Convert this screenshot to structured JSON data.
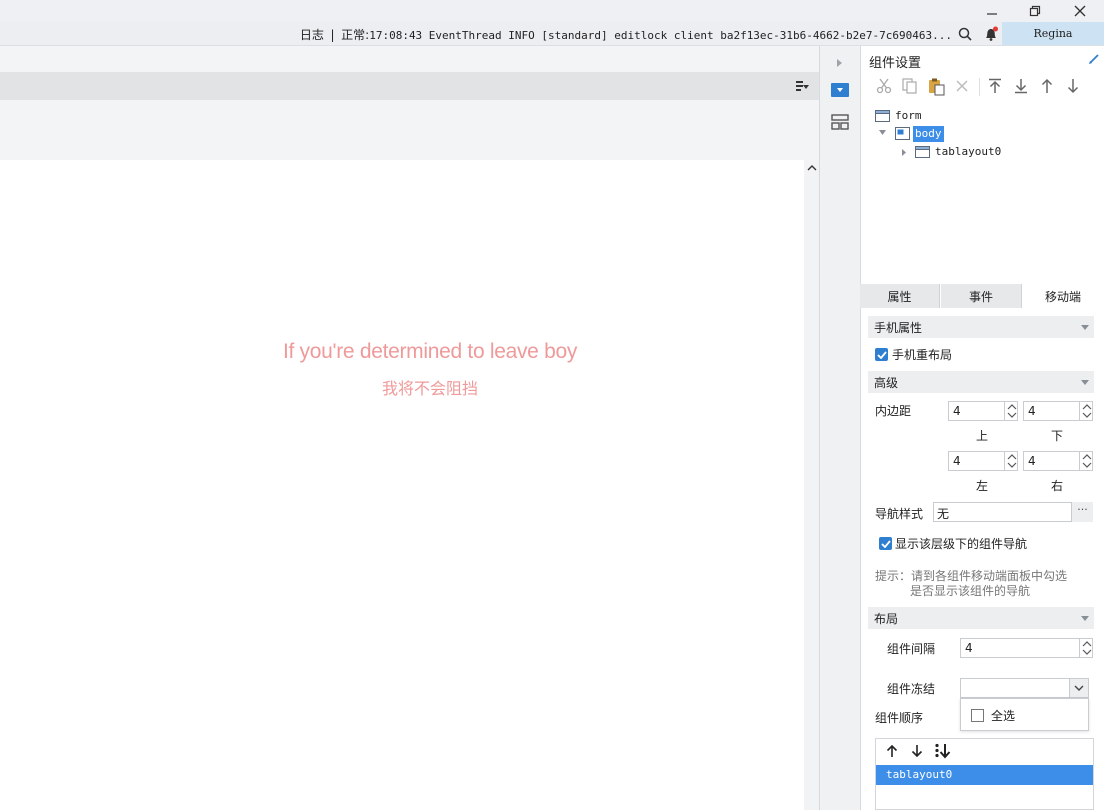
{
  "window": {
    "minimize_icon": "minimize-icon",
    "restore_icon": "restore-icon",
    "close_icon": "close-icon"
  },
  "statusbar": {
    "log_label": "日志",
    "separator": "|",
    "status_prefix": "正常:",
    "log_text": "17:08:43 EventThread INFO [standard] editlock client ba2f13ec-31b6-4662-b2e7-7c690463...",
    "user": "Regina"
  },
  "canvas": {
    "line1": "If you're determined to leave boy",
    "line2": "我将不会阻挡",
    "text_color": "#ef9a9a"
  },
  "panel": {
    "title": "组件设置",
    "tree": [
      {
        "label": "form"
      },
      {
        "label": "body"
      },
      {
        "label": "tablayout0"
      }
    ],
    "tabs": [
      "属性",
      "事件",
      "移动端"
    ],
    "active_tab": "移动端",
    "sections": {
      "mobile_props": "手机属性",
      "mobile_relayout": "手机重布局",
      "advanced": "高级",
      "padding_label": "内边距",
      "padding": {
        "top": {
          "value": "4",
          "label": "上"
        },
        "bottom": {
          "value": "4",
          "label": "下"
        },
        "left": {
          "value": "4",
          "label": "左"
        },
        "right": {
          "value": "4",
          "label": "右"
        }
      },
      "nav_style_label": "导航样式",
      "nav_style_value": "无",
      "nav_style_more": "···",
      "show_nav": "显示该层级下的组件导航",
      "hint_1": "提示：请到各组件移动端面板中勾选",
      "hint_2": "是否显示该组件的导航",
      "layout": "布局",
      "gap_label": "组件间隔",
      "gap_value": "4",
      "freeze_label": "组件冻结",
      "freeze_value": "",
      "freeze_option": "全选",
      "order_label": "组件顺序",
      "order_items": [
        "tablayout0"
      ]
    }
  },
  "colors": {
    "accent": "#2f7fd1",
    "selection": "#3d8ee8",
    "lyric": "#ef9a9a"
  }
}
